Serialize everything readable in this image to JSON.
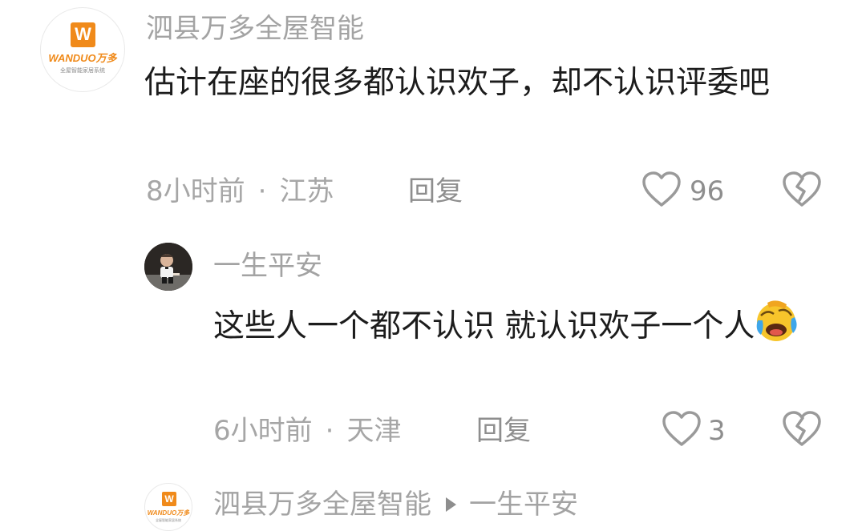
{
  "comments": [
    {
      "author": "泗县万多全屋智能",
      "avatar_icon": "wanduo-logo",
      "avatar_logo_letter": "W",
      "avatar_logo_word": "WANDUO万多",
      "avatar_logo_tagline": "全屋智能家居系统",
      "text": "估计在座的很多都认识欢子，却不认识评委吧",
      "time": "8小时前",
      "location": "江苏",
      "reply_label": "回复",
      "like_count": "96"
    },
    {
      "author": "一生平安",
      "avatar_icon": "child-photo-avatar",
      "text": "这些人一个都不认识 就认识欢子一个人",
      "emoji": "laughing-crying-emoji",
      "time": "6小时前",
      "location": "天津",
      "reply_label": "回复",
      "like_count": "3"
    },
    {
      "author": "泗县万多全屋智能",
      "avatar_icon": "wanduo-logo",
      "avatar_logo_letter": "W",
      "avatar_logo_word": "WANDUO万多",
      "avatar_logo_tagline": "全屋智能家居系统",
      "reply_to": "一生平安"
    }
  ],
  "icons": {
    "like": "heart-outline-icon",
    "dislike": "broken-heart-icon",
    "reply_arrow": "play-arrow-icon"
  },
  "colors": {
    "brand_orange": "#f08a1a",
    "muted": "#a3a3a3",
    "text": "#1c1c1c"
  }
}
